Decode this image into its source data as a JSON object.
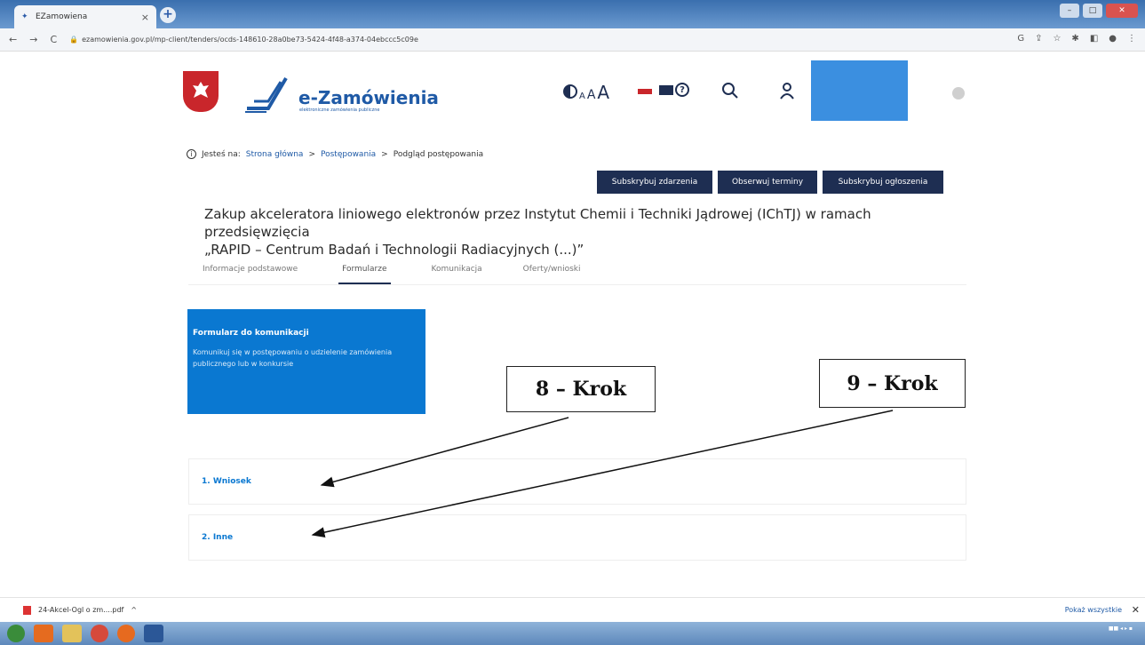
{
  "browser": {
    "tab_title": "EZamowiena",
    "url": "ezamowienia.gov.pl/mp-client/tenders/ocds-148610-28a0be73-5424-4f48-a374-04ebccc5c09e"
  },
  "header": {
    "logo_text": "e-Zamówienia",
    "logo_subtitle": "elektroniczne zamówienia publiczne",
    "a11y": {
      "a_small": "A",
      "a_mid": "A",
      "a_big": "A"
    }
  },
  "breadcrumb": {
    "prefix": "Jesteś na:",
    "items": [
      "Strona główna",
      "Postępowania",
      "Podgląd postępowania"
    ],
    "sep": ">"
  },
  "actions": {
    "subscribe_events": "Subskrybuj zdarzenia",
    "observe_dates": "Obserwuj terminy",
    "subscribe_notices": "Subskrybuj ogłoszenia"
  },
  "title": {
    "line1": "Zakup akceleratora liniowego elektronów przez Instytut Chemii i Techniki Jądrowej (IChTJ) w ramach przedsięwzięcia",
    "line2": "„RAPID – Centrum Badań i Technologii Radiacyjnych (...)”"
  },
  "tabs": [
    "Informacje podstawowe",
    "Formularze",
    "Komunikacja",
    "Oferty/wnioski"
  ],
  "card": {
    "title": "Formularz do komunikacji",
    "desc": "Komunikuj się w postępowaniu o udzielenie zamówienia publicznego lub w konkursie"
  },
  "forms": [
    "1. Wniosek",
    "2. Inne"
  ],
  "annotations": [
    "8 – Krok",
    "9 – Krok"
  ],
  "downloads": {
    "file": "24-Akcel-Ogl o zm....pdf",
    "show_all": "Pokaż wszystkie"
  },
  "colors": {
    "navy": "#1e2e52",
    "accent": "#0a78d1",
    "emblem_red": "#c9262b"
  }
}
